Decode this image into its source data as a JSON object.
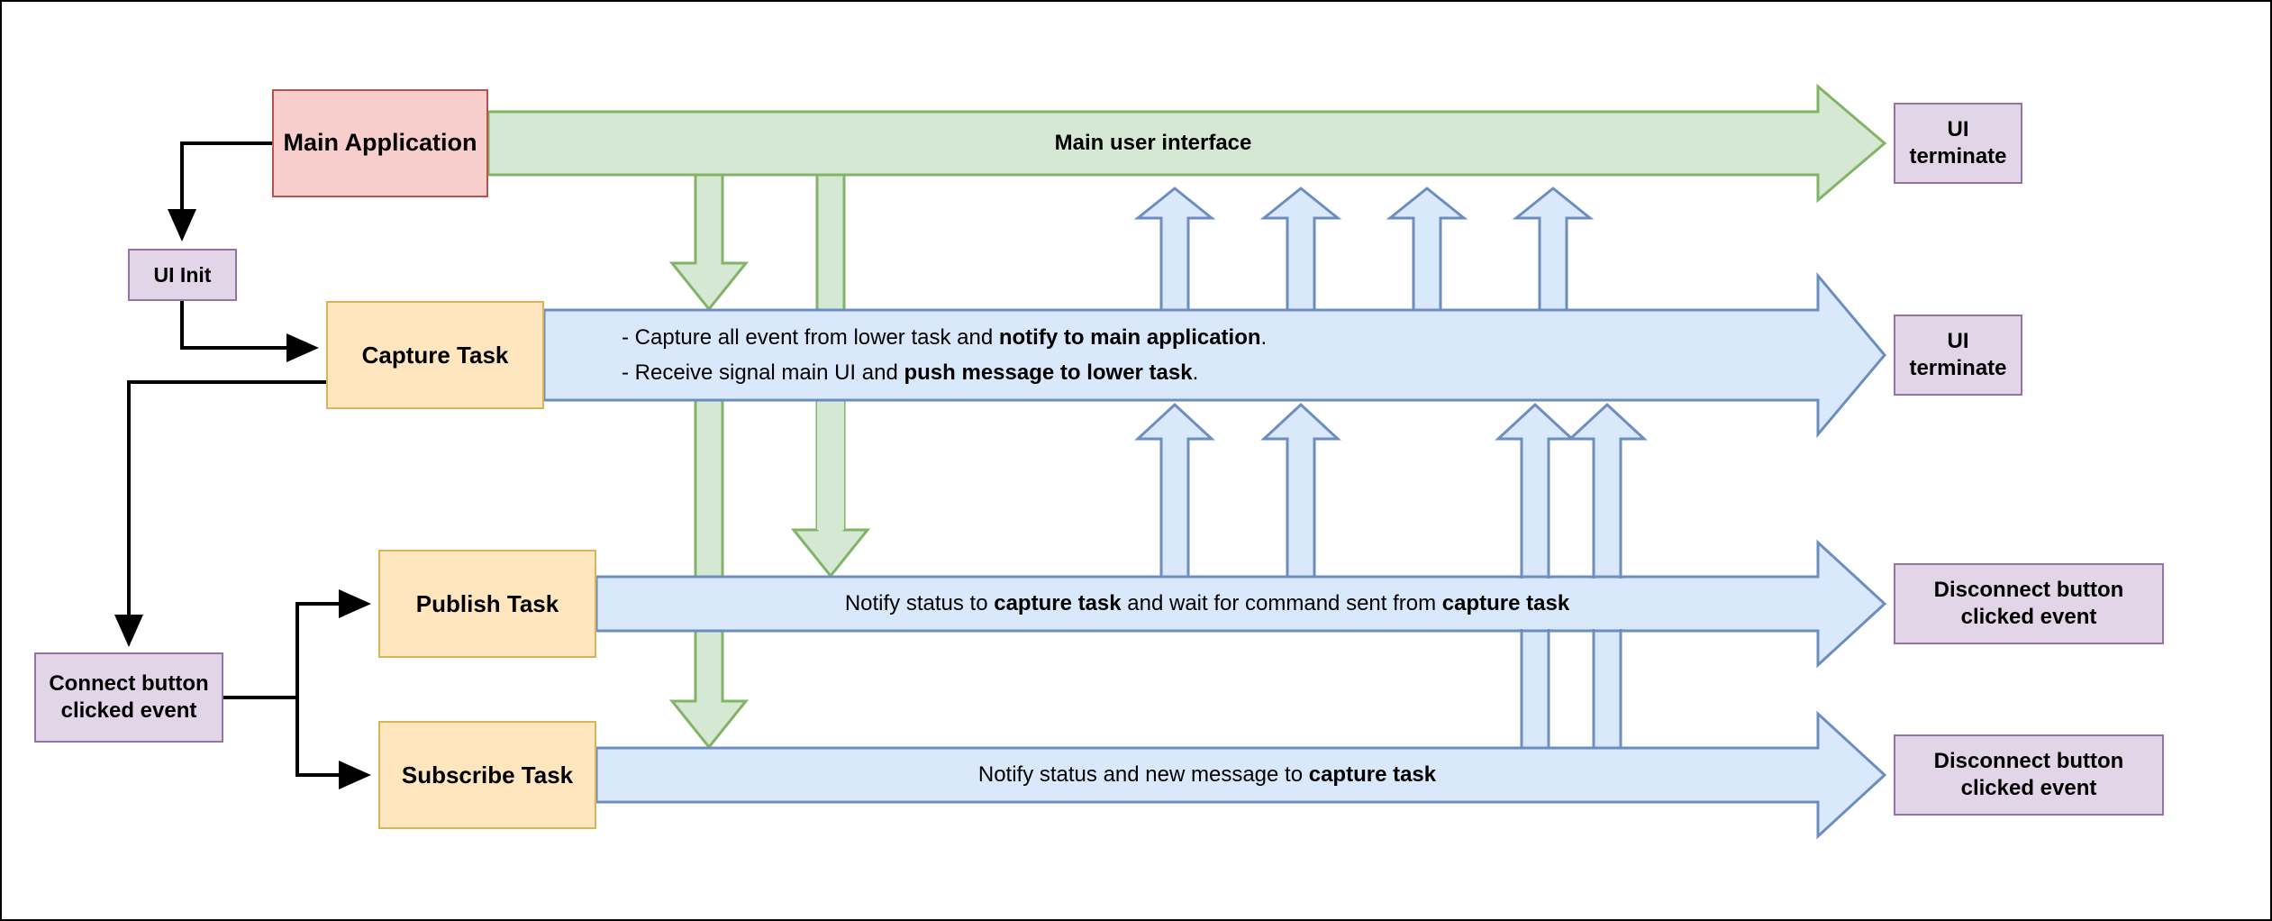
{
  "diagram": {
    "title": "Task architecture flow diagram",
    "colors": {
      "main_app_fill": "#f8cecc",
      "main_app_stroke": "#b85450",
      "event_fill": "#e1d5e7",
      "event_stroke": "#9673a6",
      "task_fill": "#ffe6bf",
      "task_stroke": "#d6b656",
      "green_band_fill": "#d5e8d4",
      "green_band_stroke": "#82b366",
      "blue_band_fill": "#dae8fc",
      "blue_band_stroke": "#6c8ebf",
      "connector_stroke": "#000000",
      "canvas_border": "#000000",
      "background": "#ffffff"
    },
    "nodes": {
      "main_application": "Main Application",
      "ui_init": "UI Init",
      "capture_task": "Capture Task",
      "publish_task": "Publish Task",
      "subscribe_task": "Subscribe Task",
      "connect_button_event": "Connect button\nclicked event",
      "connect_button_event_line1": "Connect button",
      "connect_button_event_line2": "clicked event",
      "ui_terminate_top_line1": "UI",
      "ui_terminate_top_line2": "terminate",
      "ui_terminate_capture_line1": "UI",
      "ui_terminate_capture_line2": "terminate",
      "disconnect_publish_line1": "Disconnect button",
      "disconnect_publish_line2": "clicked event",
      "disconnect_subscribe_line1": "Disconnect button",
      "disconnect_subscribe_line2": "clicked event"
    },
    "bands": {
      "main_ui": {
        "label": "Main user interface",
        "color": "green"
      },
      "capture": {
        "color": "blue",
        "line1_a": "- Capture all event from lower task and ",
        "line1_b": "notify to main application",
        "line1_c": ".",
        "line2_a": "- Receive signal main UI and ",
        "line2_b": "push message to lower task",
        "line2_c": "."
      },
      "publish": {
        "color": "blue",
        "text_a": "Notify status to ",
        "text_b": "capture task",
        "text_c": " and wait for command sent from ",
        "text_d": "capture task"
      },
      "subscribe": {
        "color": "blue",
        "text_a": "Notify status and new message to ",
        "text_b": "capture task"
      }
    },
    "flow": {
      "green_down_arrows_count": 4,
      "blue_up_arrows_upper_count": 4,
      "blue_up_arrows_lower_count": 4,
      "green_arrow_direction": "down",
      "blue_arrow_direction": "up"
    }
  }
}
